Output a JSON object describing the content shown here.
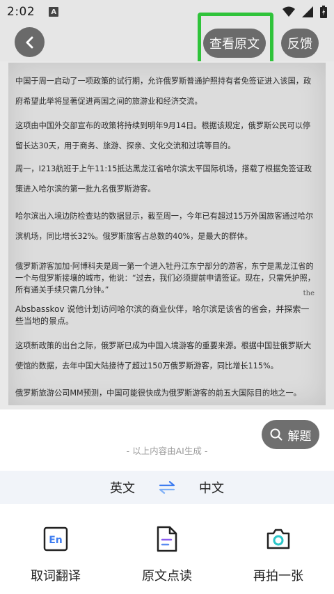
{
  "status_bar": {
    "time": "2:02",
    "notification_icon_letter": "A"
  },
  "header": {
    "view_original_label": "查看原文",
    "feedback_label": "反馈"
  },
  "document": {
    "paragraphs": [
      "中国于周一启动了一项政策的试行期，允许俄罗斯普通护照持有者免签证进入该国，政府希望此举将显著促进两国之间的旅游业和经济交流。",
      "这项由中国外交部宣布的政策将持续到明年9月14日。根据该规定，俄罗斯公民可以停留长达30天，用于商务、旅游、探亲、文化交流和过境等目的。",
      "周一，I213航班于上午11:15抵达黑龙江省哈尔滨太平国际机场，搭载了根据免签证政策进入哈尔滨的第一批九名俄罗斯游客。",
      "哈尔滨出入境边防检查站的数据显示，截至周一，今年已有超过15万外国旅客通过哈尔滨机场，同比增长32%。俄罗斯旅客占总数的40%，是最大的群体。",
      "俄罗斯游客加加·阿博科夫是周一第一个进入牡丹江东宁部分的游客，东宁是黑龙江省的一个与俄罗斯接壤的城市，他说：“过去，我们必须提前申请签证。现在，只需凭护照，所有通关手续只需几分钟。”",
      "Absbasskov 说他计划访问哈尔滨的商业伙伴，哈尔滨是该省的省会，并探索一些当地的景点。",
      "这项新政策的出台之际，俄罗斯已成为中国入境游客的重要来源。根据中国驻俄罗斯大使馆的数据，去年中国大陆接待了超过150万俄罗斯游客，同比增长115%。",
      "俄罗斯旅游公司MM预测，中国可能很快成为俄罗斯游客的前五大国际目的地之一。"
    ],
    "side_note": "the"
  },
  "solve_button_label": "解题",
  "ai_note": "- 以上内容由AI生成 -",
  "language": {
    "source": "英文",
    "target": "中文"
  },
  "tools": {
    "word_translate": {
      "label": "取词翻译",
      "icon_text": "En"
    },
    "read_aloud": {
      "label": "原文点读"
    },
    "retake": {
      "label": "再拍一张"
    }
  },
  "colors": {
    "highlight_green": "#2fc33a",
    "accent_blue": "#3d7cf0",
    "icon_cyan": "#2bc6c9",
    "button_gray": "#6b6b6b"
  }
}
